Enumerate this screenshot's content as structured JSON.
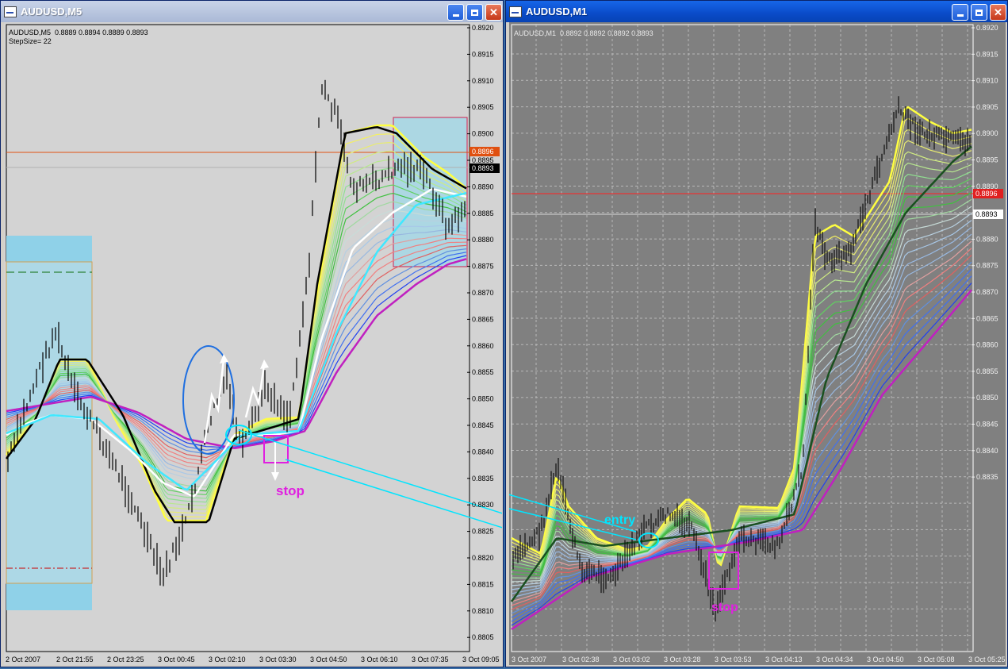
{
  "windows": {
    "m5": {
      "title": "AUDUSD,M5",
      "info": "AUDUSD,M5  0.8889 0.8894 0.8889 0.8893",
      "step": "StepSize= 22",
      "price_labels": [
        "0.8920",
        "0.8915",
        "0.8910",
        "0.8905",
        "0.8900",
        "0.8895",
        "0.8890",
        "0.8885",
        "0.8880",
        "0.8875",
        "0.8870",
        "0.8865",
        "0.8860",
        "0.8855",
        "0.8850",
        "0.8845",
        "0.8840",
        "0.8835",
        "0.8830",
        "0.8825",
        "0.8820",
        "0.8815",
        "0.8810",
        "0.8805"
      ],
      "price_tag_red": "0.8896",
      "price_tag_black": "0.8893",
      "time_labels": [
        "2 Oct 2007",
        "2 Oct 21:55",
        "2 Oct 23:25",
        "3 Oct 00:45",
        "3 Oct 02:10",
        "3 Oct 03:30",
        "3 Oct 04:50",
        "3 Oct 06:10",
        "3 Oct 07:35",
        "3 Oct 09:05"
      ],
      "annotation_stop": "stop"
    },
    "m1": {
      "title": "AUDUSD,M1",
      "info": "AUDUSD,M1  0.8892 0.8892 0.8892 0.8893",
      "price_labels": [
        "0.8920",
        "0.8915",
        "0.8910",
        "0.8905",
        "0.8900",
        "0.8895",
        "0.8890",
        "0.8885",
        "0.8880",
        "0.8875",
        "0.8870",
        "0.8865",
        "0.8860",
        "0.8855",
        "0.8850",
        "0.8845",
        "0.8840",
        "0.8835"
      ],
      "price_tag_red": "0.8896",
      "price_tag_white": "0.8893",
      "time_labels": [
        "3 Oct 2007",
        "3 Oct 02:38",
        "3 Oct 03:02",
        "3 Oct 03:28",
        "3 Oct 03:53",
        "3 Oct 04:13",
        "3 Oct 04:34",
        "3 Oct 04:50",
        "3 Oct 05:08",
        "3 Oct 05:25"
      ],
      "annotation_entry": "entry",
      "annotation_stop": "stop"
    }
  },
  "colors": {
    "m5_bg": "#d3d3d3",
    "m1_bg": "#808080",
    "accent_cyan": "#00e5ff",
    "annotation_magenta": "#e020e0",
    "bull_yellow": "#ffff00"
  },
  "icons": [
    "app-icon",
    "minimize-icon",
    "maximize-icon",
    "close-icon"
  ]
}
